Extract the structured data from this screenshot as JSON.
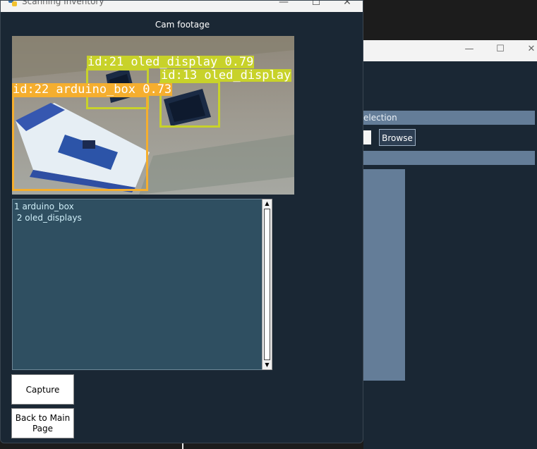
{
  "background_window": {
    "selection_label": "election",
    "browse_label": "Browse"
  },
  "main_window": {
    "title": "Scanning Inventory",
    "minimize_glyph": "—",
    "maximize_glyph": "☐",
    "close_glyph": "✕"
  },
  "cam_label": "Cam footage",
  "detections": [
    {
      "label": "id:21 oled_display 0.79",
      "color": "#c8d22a"
    },
    {
      "label": "id:13 oled_display",
      "color": "#c8d22a"
    },
    {
      "label": "id:22 arduino_box 0.73",
      "color": "#f5ae2e"
    }
  ],
  "inventory_list": [
    "1 arduino_box",
    " 2 oled_displays"
  ],
  "scroll": {
    "up": "▲",
    "down": "▼"
  },
  "buttons": {
    "capture": "Capture",
    "back": "Back to Main Page"
  },
  "colors": {
    "window_bg": "#1a2734",
    "list_bg": "#2f4f61",
    "oled_box": "#c8d22a",
    "arduino_box": "#f5ae2e"
  }
}
